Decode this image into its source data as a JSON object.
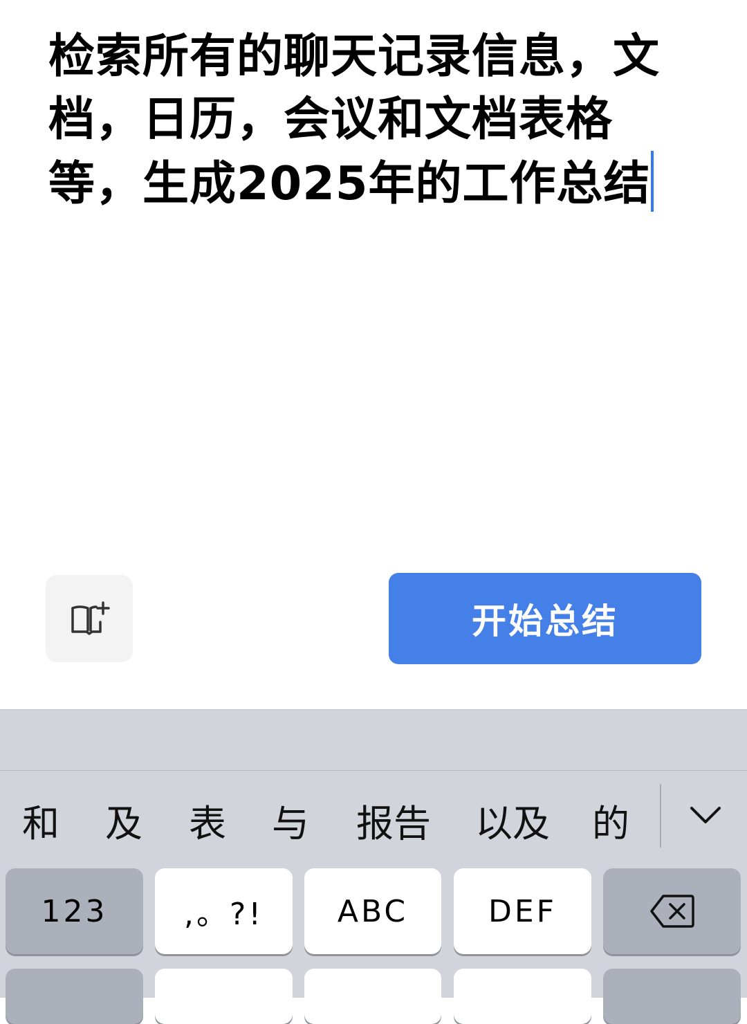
{
  "editor": {
    "text": "检索所有的聊天记录信息，文档，日历，会议和文档表格等，生成2025年的工作总结"
  },
  "actions": {
    "knowledge_icon": "book-plus-icon",
    "summary_button_label": "开始总结",
    "accent_color": "#4480e8"
  },
  "keyboard": {
    "candidates": [
      "和",
      "及",
      "表",
      "与",
      "报告",
      "以及",
      "的"
    ],
    "expand_icon": "chevron-down-icon",
    "keys": {
      "num": "123",
      "punct": ",。?!",
      "abc": "ABC",
      "def": "DEF",
      "delete_icon": "backspace-icon"
    }
  }
}
